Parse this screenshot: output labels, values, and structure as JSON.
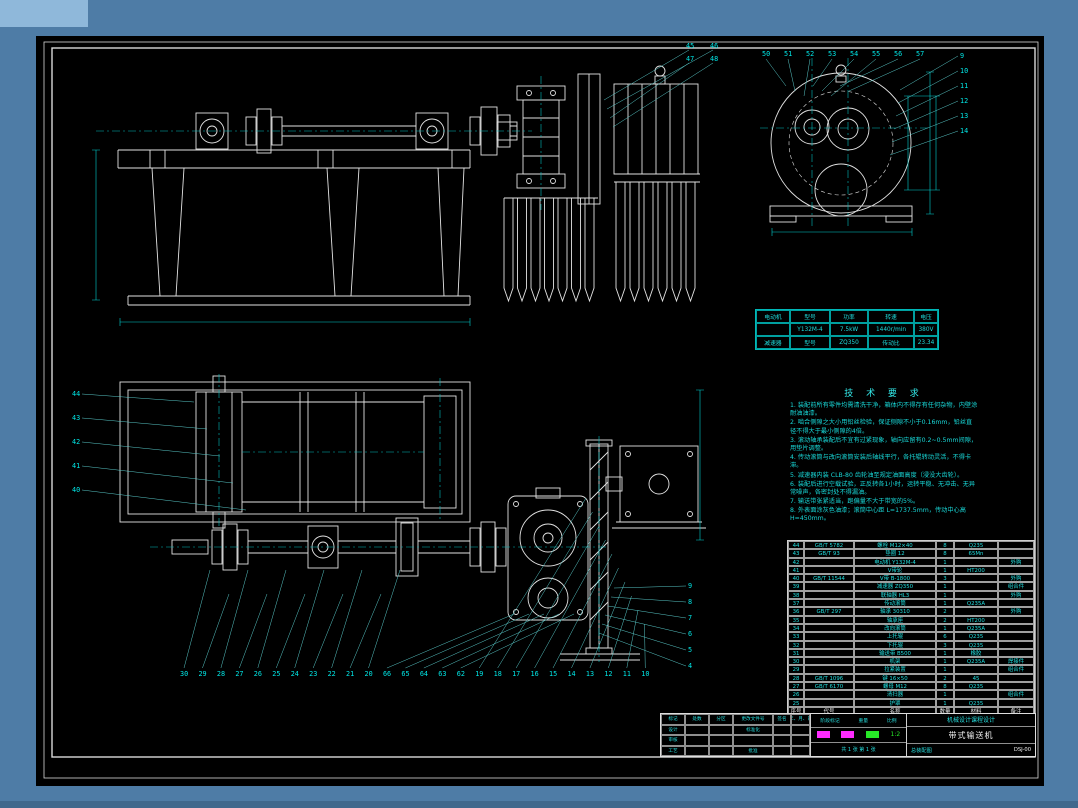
{
  "colors": {
    "background": "#4e7ca6",
    "sheet": "#000000",
    "line": "#e2e2e2",
    "cyan": "#00e6e6",
    "magenta": "#ff2bff",
    "green": "#27e827"
  },
  "tech_requirements": {
    "title": "技 术 要 求",
    "lines": [
      "1. 装配前所有零件均需清洗干净，箱体内不得存有任何杂物，内壁涂耐油油漆。",
      "2. 啮合侧隙之大小用铅丝检验，保证侧隙不小于0.16mm，铅丝直径不得大于最小侧隙的4倍。",
      "3. 滚动轴承装配后不宜有过紧现象，轴向应留有0.2~0.5mm间隙，用垫片调整。",
      "4. 传动滚筒与改向滚筒安装后轴线平行，各托辊转动灵活，不得卡滞。",
      "5. 减速器内装 CLB-80 齿轮油至规定油面高度（浸没大齿轮）。",
      "6. 装配后进行空载试验，正反转各1小时，运转平稳、无冲击、无异常噪声，各密封处不得漏油。",
      "7. 输送带张紧适当，跑偏量不大于带宽的5%。",
      "8. 外表面涂灰色油漆；滚筒中心距 L=1737.5mm，传动中心高 H=450mm。"
    ]
  },
  "motor_table": {
    "rows": [
      [
        "电动机",
        "型号",
        "功率",
        "转速",
        "电压"
      ],
      [
        "",
        "Y132M-4",
        "7.5kW",
        "1440r/min",
        "380V"
      ],
      [
        "减速器",
        "型号",
        "ZQ350",
        "传动比",
        "23.34"
      ]
    ]
  },
  "parts_table": {
    "headers": [
      "序号",
      "代号",
      "名称",
      "数量",
      "材料",
      "备注"
    ],
    "rows": [
      [
        "44",
        "GB/T 5782",
        "螺栓 M12×40",
        "8",
        "Q235",
        ""
      ],
      [
        "43",
        "GB/T 93",
        "垫圈 12",
        "8",
        "65Mn",
        ""
      ],
      [
        "42",
        "",
        "电动机 Y132M-4",
        "1",
        "",
        "外购"
      ],
      [
        "41",
        "",
        "V带轮",
        "1",
        "HT200",
        ""
      ],
      [
        "40",
        "GB/T 11544",
        "V带 B-1800",
        "3",
        "",
        "外购"
      ],
      [
        "39",
        "",
        "减速器 ZQ350",
        "1",
        "",
        "组合件"
      ],
      [
        "38",
        "",
        "联轴器 HL3",
        "1",
        "",
        "外购"
      ],
      [
        "37",
        "",
        "传动滚筒",
        "1",
        "Q235A",
        ""
      ],
      [
        "36",
        "GB/T 297",
        "轴承 30310",
        "2",
        "",
        "外购"
      ],
      [
        "35",
        "",
        "轴承座",
        "2",
        "HT200",
        ""
      ],
      [
        "34",
        "",
        "改向滚筒",
        "1",
        "Q235A",
        ""
      ],
      [
        "33",
        "",
        "上托辊",
        "6",
        "Q235",
        ""
      ],
      [
        "32",
        "",
        "下托辊",
        "3",
        "Q235",
        ""
      ],
      [
        "31",
        "",
        "输送带 B500",
        "1",
        "橡胶",
        ""
      ],
      [
        "30",
        "",
        "机架",
        "1",
        "Q235A",
        "焊接件"
      ],
      [
        "29",
        "",
        "拉紧装置",
        "1",
        "",
        "组合件"
      ],
      [
        "28",
        "GB/T 1096",
        "键 16×50",
        "2",
        "45",
        ""
      ],
      [
        "27",
        "GB/T 6170",
        "螺母 M12",
        "8",
        "Q235",
        ""
      ],
      [
        "26",
        "",
        "清扫器",
        "1",
        "",
        "组合件"
      ],
      [
        "25",
        "",
        "护罩",
        "1",
        "Q235",
        ""
      ]
    ]
  },
  "title_block": {
    "left_rows": [
      [
        "标记",
        "处数",
        "分区",
        "更改文件号",
        "签名",
        "年、月、日"
      ],
      [
        "设计",
        "",
        "",
        "标准化",
        "",
        ""
      ],
      [
        "审核",
        "",
        "",
        "",
        "",
        ""
      ],
      [
        "工艺",
        "",
        "",
        "批准",
        "",
        ""
      ]
    ],
    "stage_label": "阶段标记",
    "weight_label": "重量",
    "scale_label": "比例",
    "scale": "1:2",
    "sheet": "共 1 张  第 1 张",
    "org": "机械设计课程设计",
    "title": "带式输送机",
    "subtitle": "总装配图",
    "drawing_no": "DSJ-00"
  },
  "callouts": {
    "bottom": [
      "30",
      "29",
      "28",
      "27",
      "26",
      "25",
      "24",
      "23",
      "22",
      "21",
      "20",
      "66",
      "65",
      "64",
      "63",
      "62",
      "19",
      "18",
      "17",
      "16",
      "15",
      "14",
      "13",
      "12",
      "11",
      "10"
    ],
    "plan_left": [
      "44",
      "43",
      "42",
      "41",
      "40"
    ],
    "drive_right": [
      "9",
      "8",
      "7",
      "6",
      "5",
      "4"
    ],
    "gearbox_top": [
      "50",
      "51",
      "52",
      "53",
      "54",
      "55",
      "56",
      "57"
    ],
    "gearbox_right": [
      "9",
      "10",
      "11",
      "12",
      "13",
      "14"
    ],
    "upper_mid": [
      "45",
      "46",
      "47",
      "48"
    ]
  }
}
